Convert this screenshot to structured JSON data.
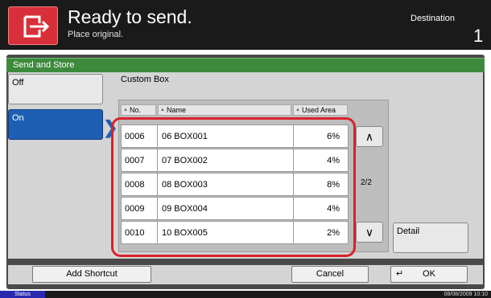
{
  "header": {
    "title": "Ready to send.",
    "subtitle": "Place original.",
    "destination_label": "Destination",
    "destination_count": "1"
  },
  "panel": {
    "title": "Send and Store",
    "off_label": "Off",
    "on_label": "On",
    "box_label": "Custom Box"
  },
  "columns": {
    "no": "No.",
    "name": "Name",
    "used": "Used Area"
  },
  "rows": [
    {
      "no": "0006",
      "name": "06 BOX001",
      "used": "6%"
    },
    {
      "no": "0007",
      "name": "07 BOX002",
      "used": "4%"
    },
    {
      "no": "0008",
      "name": "08 BOX003",
      "used": "8%"
    },
    {
      "no": "0009",
      "name": "09 BOX004",
      "used": "4%"
    },
    {
      "no": "0010",
      "name": "10 BOX005",
      "used": "2%"
    }
  ],
  "pager": {
    "page": "2/2",
    "up_icon": "chevron-up-icon",
    "down_icon": "chevron-down-icon"
  },
  "buttons": {
    "detail": "Detail",
    "add_shortcut": "Add Shortcut",
    "cancel": "Cancel",
    "ok": "OK"
  },
  "status": {
    "label": "Status",
    "datetime": "08/08/2009   10:10"
  },
  "colors": {
    "accent_green": "#3d8a3d",
    "selected_blue": "#1f5fb3",
    "highlight_red": "#d9222a"
  }
}
